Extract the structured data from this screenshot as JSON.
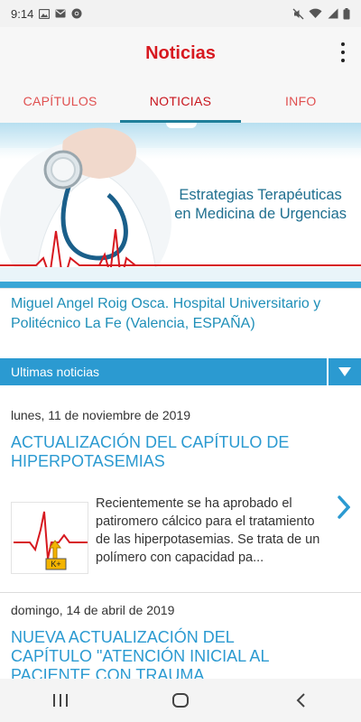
{
  "status_bar": {
    "time": "9:14",
    "left_icons": [
      "image-icon",
      "email-icon",
      "chrome-icon"
    ],
    "right_icons": [
      "mute-icon",
      "wifi-icon",
      "signal-icon",
      "battery-icon"
    ]
  },
  "app_bar": {
    "title": "Noticias",
    "overflow_icon": "more-vert-icon"
  },
  "tabs": [
    {
      "label": "CAPÍTULOS",
      "active": false
    },
    {
      "label": "NOTICIAS",
      "active": true
    },
    {
      "label": "INFO",
      "active": false
    }
  ],
  "banner": {
    "title_line1": "Estrategias Terapéuticas",
    "title_line2": "en Medicina de Urgencias"
  },
  "author": {
    "text": "Miguel Angel Roig Osca. Hospital Universitario y Politécnico La Fe (Valencia, ESPAÑA)"
  },
  "section": {
    "label": "Ultimas noticias",
    "toggle_icon": "caret-down-icon"
  },
  "news": [
    {
      "date": "lunes, 11 de noviembre de 2019",
      "title": "ACTUALIZACIÓN DEL CAPÍTULO DE HIPERPOTASEMIAS",
      "summary": "Recientemente se ha aprobado el patiromero cálcico para el tratamiento de las hiperpotasemias. Se trata de un polímero con capacidad pa...",
      "thumb_label": "K+"
    },
    {
      "date": "domingo, 14 de abril de 2019",
      "title": "NUEVA ACTUALIZACIÓN DEL CAPÍTULO \"ATENCIÓN INICIAL AL PACIENTE CON TRAUMA"
    }
  ],
  "nav_bar": {
    "buttons": [
      "recent-apps-icon",
      "home-icon",
      "back-icon"
    ]
  },
  "colors": {
    "brand_red": "#d71920",
    "accent_blue": "#2b9ad1",
    "tab_indicator": "#1f7f9a"
  }
}
